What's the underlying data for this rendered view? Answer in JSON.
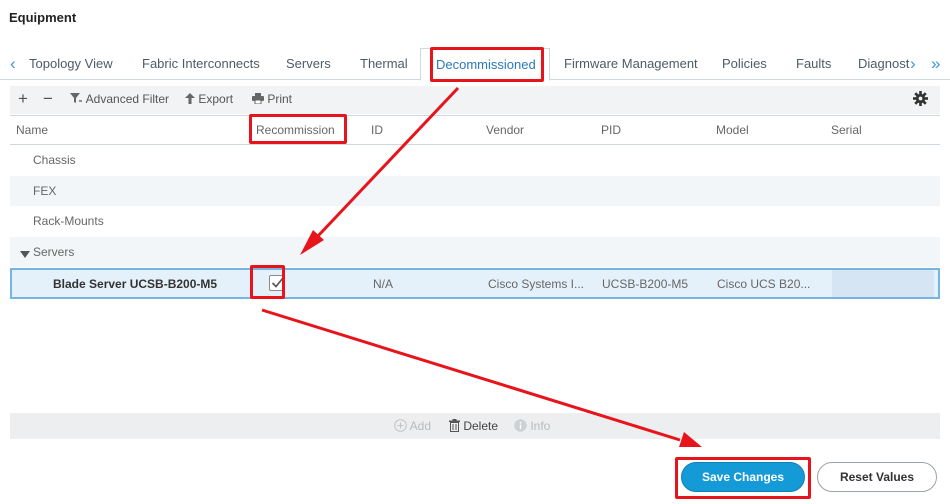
{
  "page": {
    "title": "Equipment"
  },
  "tabs": {
    "prev_glyph": "‹",
    "next_glyph": "›",
    "more_glyph": "»",
    "items": [
      {
        "label": "Topology View"
      },
      {
        "label": "Fabric Interconnects"
      },
      {
        "label": "Servers"
      },
      {
        "label": "Thermal"
      },
      {
        "label": "Decommissioned",
        "active": true
      },
      {
        "label": "Firmware Management"
      },
      {
        "label": "Policies"
      },
      {
        "label": "Faults"
      },
      {
        "label": "Diagnost"
      }
    ]
  },
  "toolbar": {
    "add_glyph": "+",
    "remove_glyph": "−",
    "advanced_filter": "Advanced Filter",
    "export": "Export",
    "print": "Print"
  },
  "table": {
    "columns": [
      "Name",
      "Recommission",
      "ID",
      "Vendor",
      "PID",
      "Model",
      "Serial"
    ],
    "groups": [
      {
        "label": "Chassis"
      },
      {
        "label": "FEX"
      },
      {
        "label": "Rack-Mounts"
      },
      {
        "label": "Servers",
        "expanded": true
      }
    ],
    "selected_row": {
      "name": "Blade Server UCSB-B200-M5",
      "recommission_checked": true,
      "id": "N/A",
      "vendor": "Cisco Systems I...",
      "pid": "UCSB-B200-M5",
      "model": "Cisco UCS B20...",
      "serial": ""
    }
  },
  "bottom_actions": {
    "add": "Add",
    "delete": "Delete",
    "info": "Info"
  },
  "buttons": {
    "save": "Save Changes",
    "reset": "Reset Values"
  },
  "colors": {
    "accent": "#159ad8",
    "annotation": "#e8141b",
    "selection": "#e5f1fa"
  }
}
